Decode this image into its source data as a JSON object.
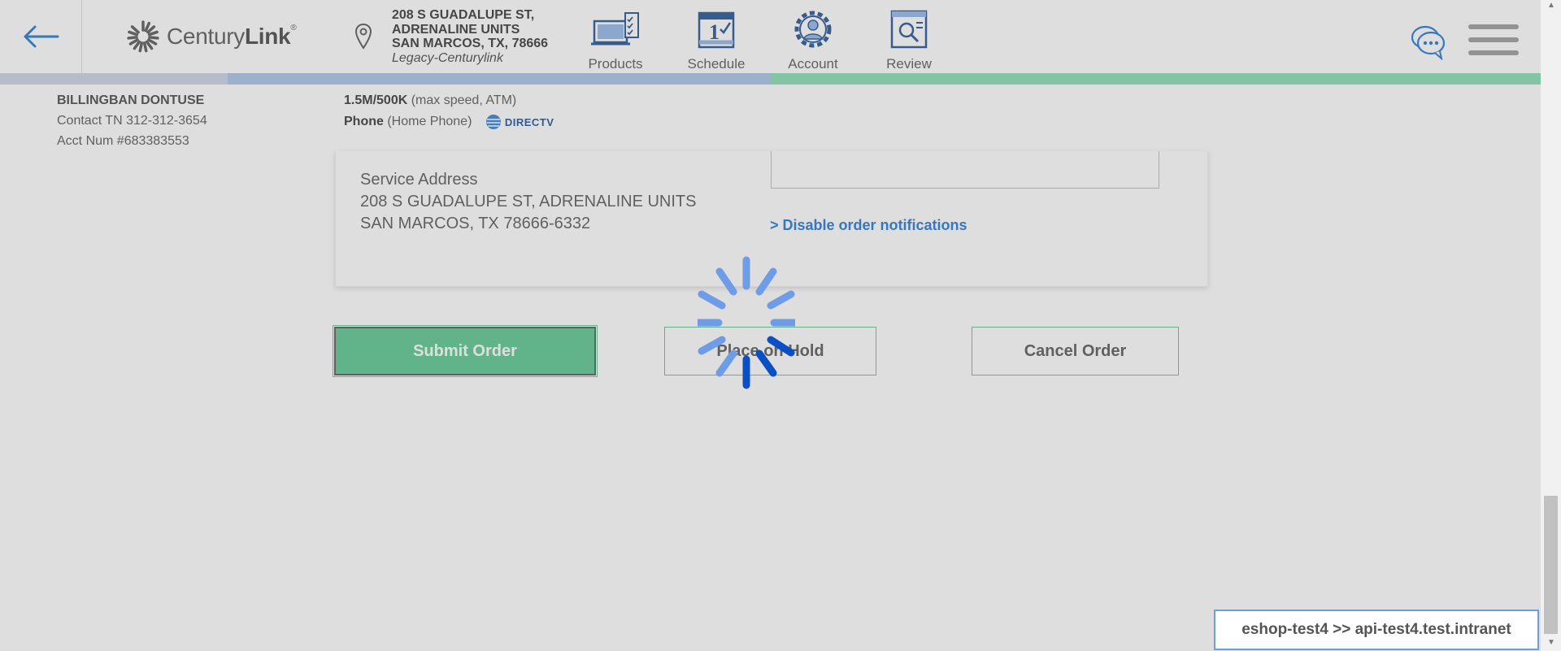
{
  "header": {
    "logo_text_light": "Century",
    "logo_text_bold": "Link",
    "logo_reg": "®",
    "address_line1": "208 S GUADALUPE ST,",
    "address_line2": "ADRENALINE UNITS",
    "address_line3": "SAN MARCOS, TX, 78666",
    "account_type": "Legacy-Centurylink",
    "nav": [
      {
        "label": "Products",
        "icon": "tv-checklist-icon"
      },
      {
        "label": "Schedule",
        "icon": "calendar-icon"
      },
      {
        "label": "Account",
        "icon": "user-gear-icon"
      },
      {
        "label": "Review",
        "icon": "review-document-icon"
      }
    ]
  },
  "progress": {
    "segments": [
      {
        "color": "#c9d3e3",
        "fraction": 0.148
      },
      {
        "color": "#a8c1ea",
        "fraction": 0.352
      },
      {
        "color": "#84dcb1",
        "fraction": 0.5
      }
    ]
  },
  "customer": {
    "name": "BILLINGBAN DONTUSE",
    "contact": "Contact TN 312-312-3654",
    "account": "Acct Num #683383553"
  },
  "services": {
    "speed_bold": "1.5M/500K",
    "speed_rest": "(max speed, ATM)",
    "phone_bold": "Phone",
    "phone_rest": "(Home Phone)",
    "directv": "DIRECTV"
  },
  "card": {
    "service_address_label": "Service Address",
    "service_address_line1": "208 S GUADALUPE ST, ADRENALINE UNITS",
    "service_address_line2": "SAN MARCOS, TX 78666-6332",
    "disable_link": "> Disable order notifications"
  },
  "buttons": {
    "submit": "Submit Order",
    "hold": "Place on Hold",
    "cancel": "Cancel Order"
  },
  "env_badge": "eshop-test4 >> api-test4.test.intranet",
  "colors": {
    "accent_blue": "#1d74d4",
    "accent_green": "#57c78e",
    "spinner": "#1e6fe0"
  }
}
